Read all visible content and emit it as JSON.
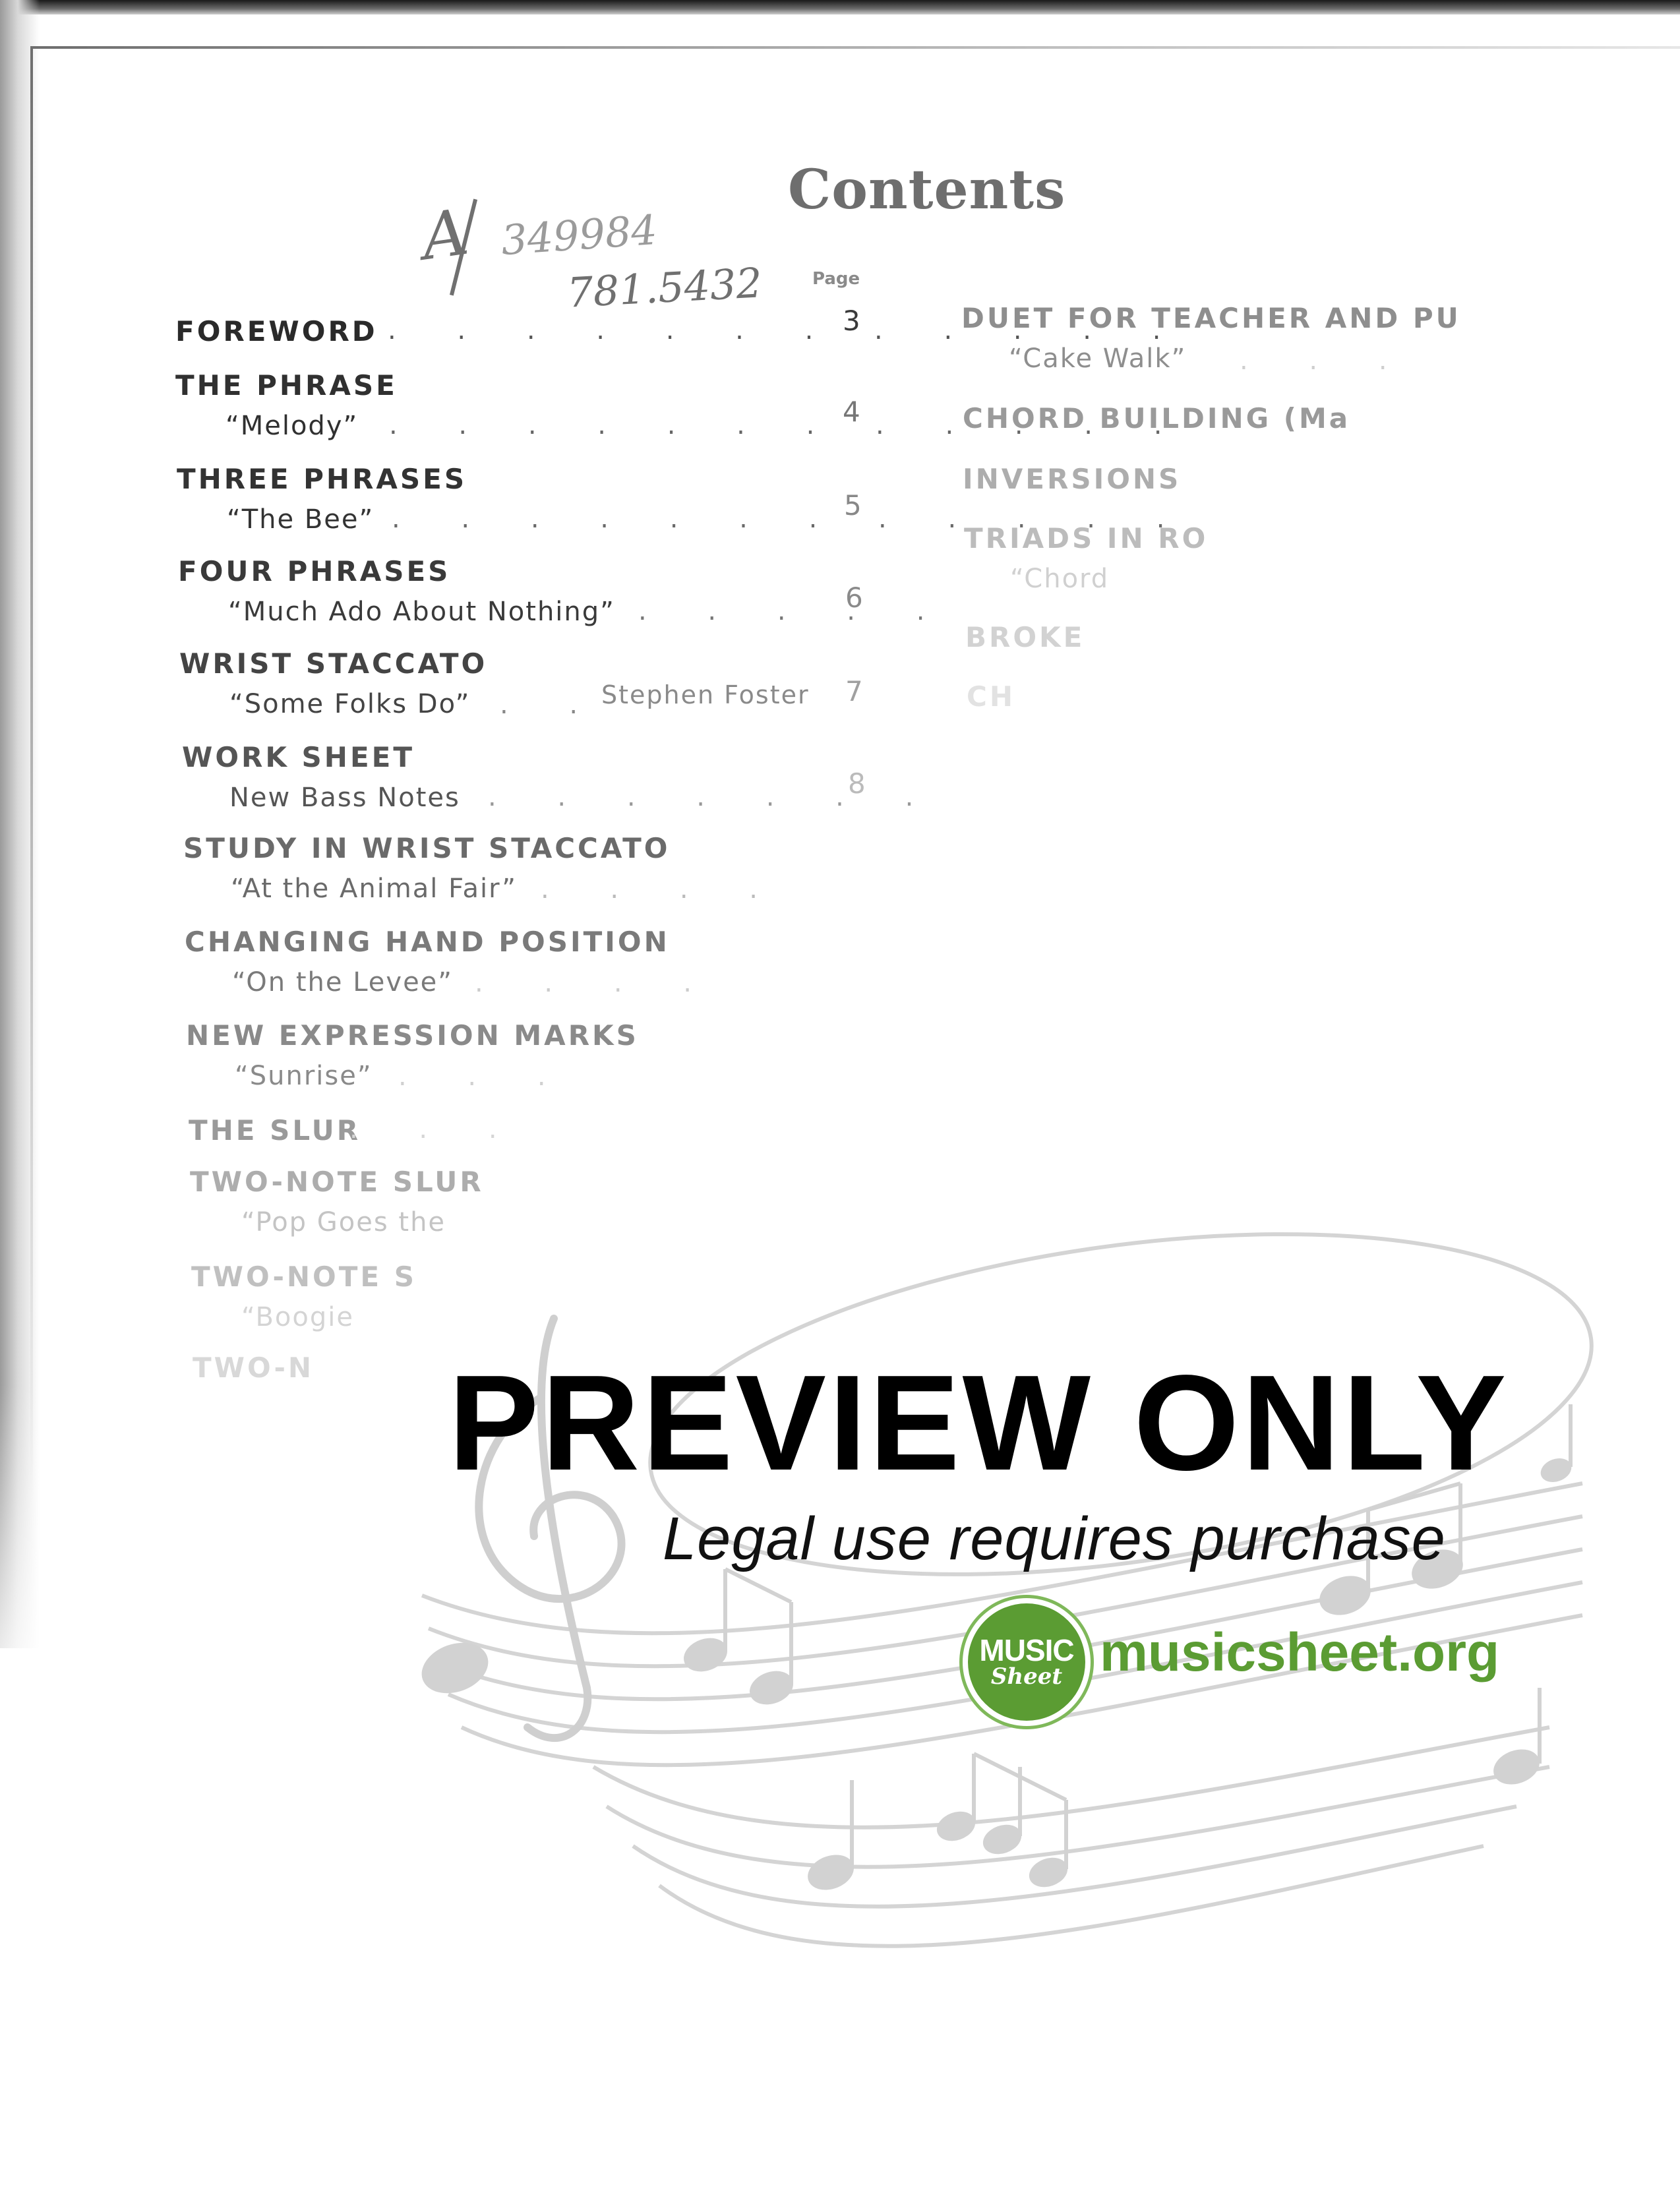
{
  "document": {
    "title": "Contents",
    "page_column_label": "Page",
    "handwritten": [
      "A",
      "349984",
      "781.5432"
    ]
  },
  "toc_left": [
    {
      "heading": "FOREWORD",
      "page": "3"
    },
    {
      "heading": "THE PHRASE",
      "subtitle": "“Melody”",
      "page": "4"
    },
    {
      "heading": "THREE PHRASES",
      "subtitle": "“The Bee”",
      "page": "5"
    },
    {
      "heading": "FOUR PHRASES",
      "subtitle": "“Much Ado About Nothing”",
      "page": "6"
    },
    {
      "heading": "WRIST STACCATO",
      "subtitle": "“Some Folks Do”",
      "composer": "Stephen Foster",
      "page": "7"
    },
    {
      "heading": "WORK SHEET",
      "subtitle": "New Bass Notes",
      "page": "8"
    },
    {
      "heading": "STUDY IN WRIST STACCATO",
      "subtitle": "“At the Animal Fair”"
    },
    {
      "heading": "CHANGING HAND POSITION",
      "subtitle": "“On the Levee”"
    },
    {
      "heading": "NEW EXPRESSION MARKS",
      "subtitle": "“Sunrise”"
    },
    {
      "heading": "THE SLUR"
    },
    {
      "heading": "TWO-NOTE SLUR",
      "subtitle": "“Pop Goes the"
    },
    {
      "heading": "TWO-NOTE S",
      "subtitle": "“Boogie"
    },
    {
      "heading": "TWO-N"
    }
  ],
  "toc_right": [
    {
      "heading": "DUET FOR TEACHER AND PU",
      "subtitle": "“Cake Walk”"
    },
    {
      "heading": "CHORD BUILDING (Ma"
    },
    {
      "heading": "INVERSIONS"
    },
    {
      "heading": "TRIADS IN RO",
      "subtitle": "“Chord"
    },
    {
      "heading": "BROKE"
    },
    {
      "heading": "CH"
    }
  ],
  "watermark": {
    "headline": "PREVIEW ONLY",
    "notice": "Legal use requires purchase",
    "logo_top": "MUSIC",
    "logo_bottom": "Sheet",
    "site": "musicsheet.org",
    "brand_color": "#5b9c33"
  }
}
